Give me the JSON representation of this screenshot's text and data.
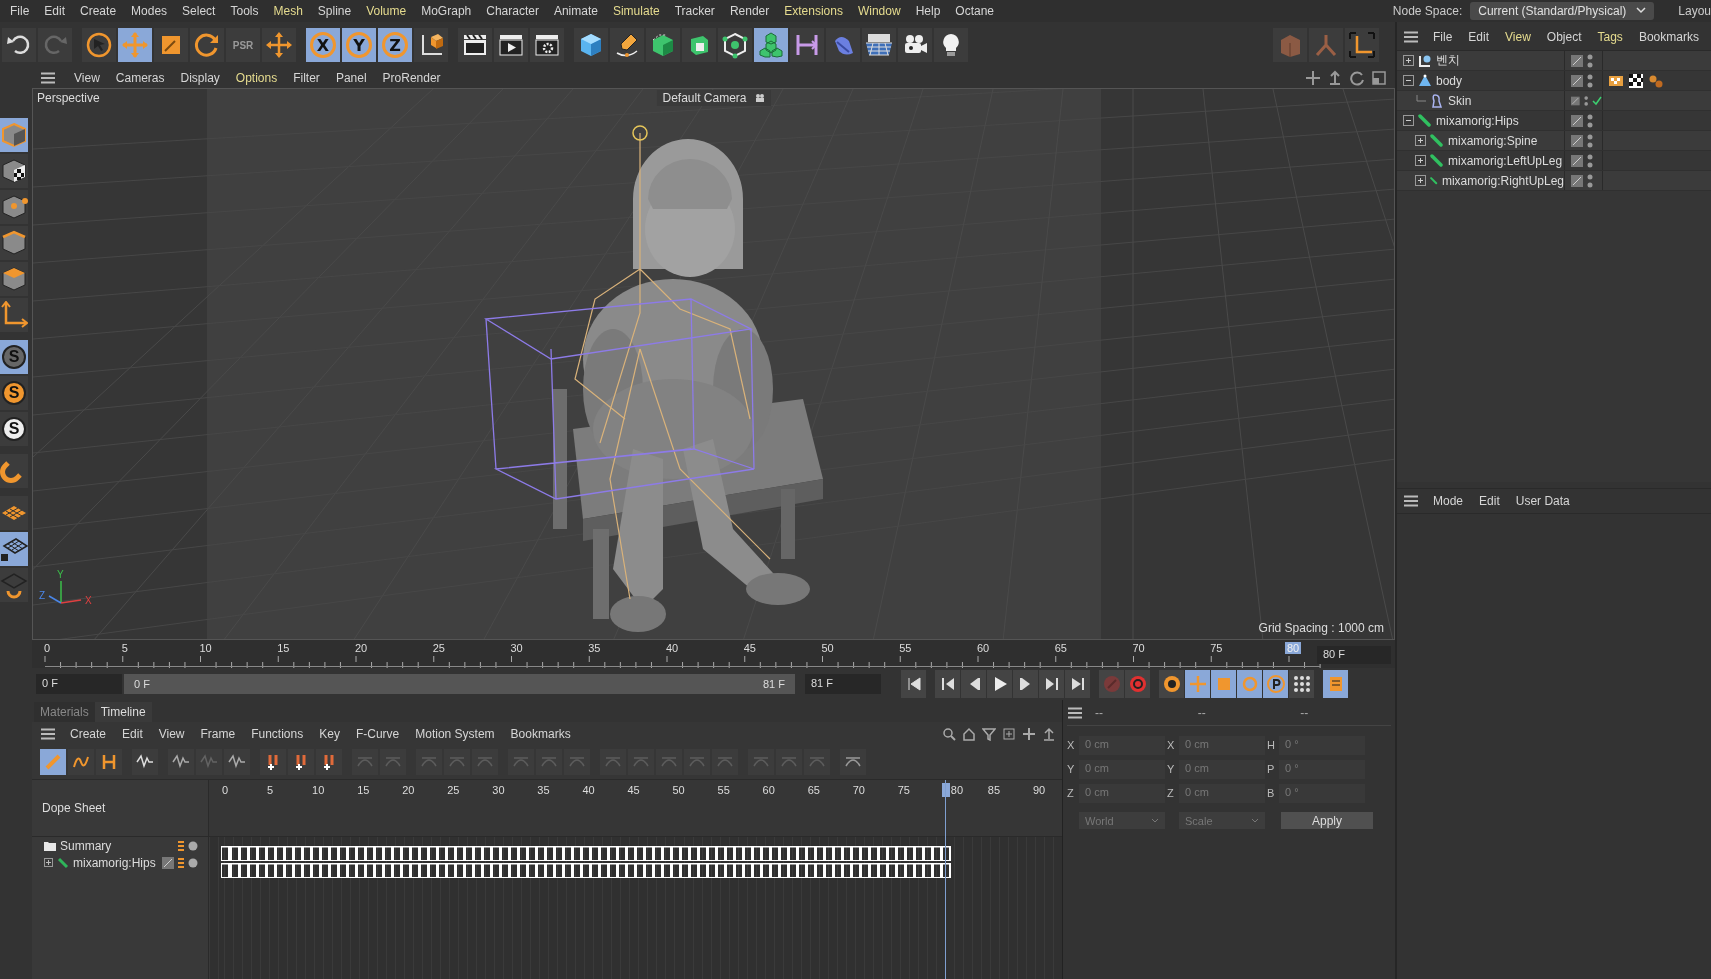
{
  "menubar": {
    "items": [
      {
        "label": "File",
        "highlighted": false
      },
      {
        "label": "Edit",
        "highlighted": false
      },
      {
        "label": "Create",
        "highlighted": false
      },
      {
        "label": "Modes",
        "highlighted": false
      },
      {
        "label": "Select",
        "highlighted": false
      },
      {
        "label": "Tools",
        "highlighted": false
      },
      {
        "label": "Mesh",
        "highlighted": true
      },
      {
        "label": "Spline",
        "highlighted": false
      },
      {
        "label": "Volume",
        "highlighted": true
      },
      {
        "label": "MoGraph",
        "highlighted": false
      },
      {
        "label": "Character",
        "highlighted": false
      },
      {
        "label": "Animate",
        "highlighted": false
      },
      {
        "label": "Simulate",
        "highlighted": true
      },
      {
        "label": "Tracker",
        "highlighted": false
      },
      {
        "label": "Render",
        "highlighted": false
      },
      {
        "label": "Extensions",
        "highlighted": true
      },
      {
        "label": "Window",
        "highlighted": true
      },
      {
        "label": "Help",
        "highlighted": false
      },
      {
        "label": "Octane",
        "highlighted": false
      }
    ],
    "node_space_label": "Node Space:",
    "node_space_value": "Current (Standard/Physical)",
    "layout_label": "Layou"
  },
  "toolbar": {
    "tools": [
      {
        "kind": "icon",
        "selected": false
      },
      {
        "kind": "icon",
        "selected": false
      },
      {
        "kind": "icon",
        "selected": false
      },
      {
        "kind": "icon",
        "selected": true
      },
      {
        "kind": "icon",
        "selected": false
      },
      {
        "kind": "icon",
        "selected": false
      },
      {
        "kind": "letter",
        "label": "PSR",
        "selected": false
      },
      {
        "kind": "icon",
        "selected": false
      },
      {
        "kind": "letter",
        "label": "X",
        "selected": true
      },
      {
        "kind": "letter",
        "label": "Y",
        "selected": true
      },
      {
        "kind": "letter",
        "label": "Z",
        "selected": true
      },
      {
        "kind": "icon",
        "selected": false
      },
      {
        "kind": "icon",
        "selected": false
      },
      {
        "kind": "icon",
        "selected": false
      },
      {
        "kind": "icon",
        "selected": false
      },
      {
        "kind": "icon",
        "selected": false
      },
      {
        "kind": "icon",
        "selected": false
      },
      {
        "kind": "icon",
        "selected": false
      },
      {
        "kind": "icon",
        "selected": false
      },
      {
        "kind": "icon",
        "selected": false
      },
      {
        "kind": "icon",
        "selected": true
      },
      {
        "kind": "icon",
        "selected": false
      },
      {
        "kind": "icon",
        "selected": false
      },
      {
        "kind": "icon",
        "selected": false
      },
      {
        "kind": "icon",
        "selected": false
      },
      {
        "kind": "icon",
        "selected": false
      },
      {
        "kind": "icon",
        "selected": false
      },
      {
        "kind": "icon",
        "selected": false
      },
      {
        "kind": "icon",
        "selected": false
      }
    ]
  },
  "side_toolbar": {
    "tools": [
      {
        "kind": "icon",
        "selected": true
      },
      {
        "kind": "icon",
        "selected": false
      },
      {
        "kind": "icon",
        "selected": false
      },
      {
        "kind": "icon",
        "selected": false
      },
      {
        "kind": "icon",
        "selected": false
      },
      {
        "kind": "icon",
        "selected": false
      },
      {
        "kind": "letter",
        "label": "S",
        "selected": true
      },
      {
        "kind": "letter",
        "label": "S",
        "selected": false
      },
      {
        "kind": "letter",
        "label": "S",
        "selected": false
      },
      {
        "kind": "icon",
        "selected": false
      },
      {
        "kind": "icon",
        "selected": false
      },
      {
        "kind": "icon",
        "selected": true
      },
      {
        "kind": "icon",
        "selected": false
      }
    ]
  },
  "viewport": {
    "menu": [
      {
        "label": "View",
        "highlighted": false
      },
      {
        "label": "Cameras",
        "highlighted": false
      },
      {
        "label": "Display",
        "highlighted": false
      },
      {
        "label": "Options",
        "highlighted": true
      },
      {
        "label": "Filter",
        "highlighted": false
      },
      {
        "label": "Panel",
        "highlighted": false
      },
      {
        "label": "ProRender",
        "highlighted": false
      }
    ],
    "title": "Perspective",
    "camera": "Default Camera",
    "grid_spacing": "Grid Spacing : 1000 cm",
    "axis_labels": [
      "Y",
      "Z",
      "X"
    ]
  },
  "timeline_ruler": {
    "labels": [
      "0",
      "5",
      "10",
      "15",
      "20",
      "25",
      "30",
      "35",
      "40",
      "45",
      "50",
      "55",
      "60",
      "65",
      "70",
      "75"
    ],
    "current": "80"
  },
  "playback": {
    "start": "0 F",
    "range": {
      "start": "0 F",
      "end": "81 F",
      "level": 1
    },
    "end": "81 F",
    "current": "80 F",
    "controls": [
      {
        "selected": false
      },
      {
        "selected": false
      },
      {
        "selected": false
      },
      {
        "selected": false
      },
      {
        "selected": false
      },
      {
        "selected": false
      },
      {
        "selected": false
      },
      {
        "selected": false
      },
      {
        "selected": false
      },
      {
        "selected": false
      },
      {
        "selected": true
      },
      {
        "selected": true
      },
      {
        "selected": true
      },
      {
        "selected": true
      },
      {
        "selected": false
      },
      {
        "selected": true
      }
    ]
  },
  "timeline_panel": {
    "tabs": [
      {
        "label": "Materials",
        "selected": false
      },
      {
        "label": "Timeline",
        "selected": true
      }
    ],
    "menu": [
      "Create",
      "Edit",
      "View",
      "Frame",
      "Functions",
      "Key",
      "F-Curve",
      "Motion System",
      "Bookmarks"
    ],
    "tools": [
      {
        "selected": true,
        "disabled": false
      },
      {
        "selected": false,
        "disabled": false
      },
      {
        "selected": false,
        "disabled": false
      },
      {
        "selected": false,
        "disabled": false
      },
      {
        "selected": false,
        "disabled": false
      },
      {
        "selected": false,
        "disabled": true
      },
      {
        "selected": false,
        "disabled": false
      },
      {
        "selected": false,
        "disabled": false
      },
      {
        "selected": false,
        "disabled": false
      },
      {
        "selected": false,
        "disabled": false
      },
      {
        "selected": false,
        "disabled": true
      },
      {
        "selected": false,
        "disabled": true
      },
      {
        "selected": false,
        "disabled": true
      },
      {
        "selected": false,
        "disabled": true
      },
      {
        "selected": false,
        "disabled": true
      },
      {
        "selected": false,
        "disabled": true
      },
      {
        "selected": false,
        "disabled": true
      },
      {
        "selected": false,
        "disabled": true
      },
      {
        "selected": false,
        "disabled": true
      },
      {
        "selected": false,
        "disabled": true
      },
      {
        "selected": false,
        "disabled": true
      },
      {
        "selected": false,
        "disabled": true
      },
      {
        "selected": false,
        "disabled": true
      },
      {
        "selected": false,
        "disabled": true
      },
      {
        "selected": false,
        "disabled": true
      },
      {
        "selected": false,
        "disabled": true
      },
      {
        "selected": false,
        "disabled": false
      }
    ],
    "mode_label": "Dope Sheet",
    "ruler": [
      "0",
      "5",
      "10",
      "15",
      "20",
      "25",
      "30",
      "35",
      "40",
      "45",
      "50",
      "55",
      "60",
      "65",
      "70",
      "75"
    ],
    "ruler_after": [
      "85",
      "90"
    ],
    "current": "80",
    "tracks": [
      {
        "name": "Summary",
        "kind": "folder"
      },
      {
        "name": "mixamorig:Hips",
        "kind": "joint"
      }
    ]
  },
  "coordinates": {
    "headers": [
      "--",
      "--",
      "--"
    ],
    "rows": [
      {
        "axis": "X",
        "position": "0 cm",
        "size_axis": "X",
        "size": "0 cm",
        "rotation_axis": "H",
        "rotation": "0 °"
      },
      {
        "axis": "Y",
        "position": "0 cm",
        "size_axis": "Y",
        "size": "0 cm",
        "rotation_axis": "P",
        "rotation": "0 °"
      },
      {
        "axis": "Z",
        "position": "0 cm",
        "size_axis": "Z",
        "size": "0 cm",
        "rotation_axis": "B",
        "rotation": "0 °"
      }
    ],
    "space": "World",
    "mode": "Scale",
    "apply": "Apply"
  },
  "object_manager": {
    "menu": [
      {
        "label": "File",
        "highlighted": false
      },
      {
        "label": "Edit",
        "highlighted": false
      },
      {
        "label": "View",
        "highlighted": true
      },
      {
        "label": "Object",
        "highlighted": false
      },
      {
        "label": "Tags",
        "highlighted": true
      },
      {
        "label": "Bookmarks",
        "highlighted": false
      }
    ],
    "objects": [
      {
        "name": "벤치",
        "kind": "connector",
        "expanded": false,
        "check": false
      },
      {
        "name": "body",
        "kind": "polygon",
        "expanded": true,
        "check": false,
        "tags": [
          {
            "kind": "texture"
          },
          {
            "kind": "material"
          },
          {
            "kind": "weight"
          }
        ],
        "children": [
          {
            "name": "Skin",
            "kind": "skin",
            "check": true
          }
        ]
      },
      {
        "name": "mixamorig:Hips",
        "kind": "joint",
        "expanded": true,
        "check": false,
        "children": [
          {
            "name": "mixamorig:Spine",
            "kind": "joint",
            "expanded": false,
            "check": false
          },
          {
            "name": "mixamorig:LeftUpLeg",
            "kind": "joint",
            "expanded": false,
            "check": false
          },
          {
            "name": "mixamorig:RightUpLeg",
            "kind": "joint",
            "expanded": false,
            "check": false
          }
        ]
      }
    ]
  },
  "attributes": {
    "menu": [
      "Mode",
      "Edit",
      "User Data"
    ]
  }
}
